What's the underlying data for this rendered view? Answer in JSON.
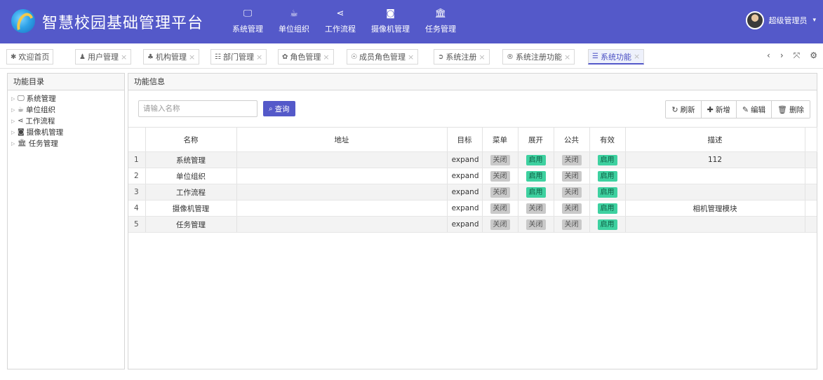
{
  "header": {
    "title": "智慧校园基础管理平台",
    "nav": [
      {
        "label": "系统管理",
        "icon": "monitor-icon",
        "glyph": "🖵"
      },
      {
        "label": "单位组织",
        "icon": "coffee-cup-icon",
        "glyph": "☕"
      },
      {
        "label": "工作流程",
        "icon": "share-icon",
        "glyph": "⋖"
      },
      {
        "label": "摄像机管理",
        "icon": "camera-icon",
        "glyph": "◙"
      },
      {
        "label": "任务管理",
        "icon": "bank-icon",
        "glyph": "🏛"
      }
    ],
    "user": {
      "name": "超级管理员",
      "caret": "▾"
    }
  },
  "tabs": [
    {
      "label": "欢迎首页",
      "glyph": "✱",
      "icon": "home-icon",
      "closable": false
    },
    {
      "label": "用户管理",
      "glyph": "♟",
      "icon": "user-icon",
      "closable": true
    },
    {
      "label": "机构管理",
      "glyph": "♣",
      "icon": "sitemap-icon",
      "closable": true
    },
    {
      "label": "部门管理",
      "glyph": "☷",
      "icon": "list-icon",
      "closable": true
    },
    {
      "label": "角色管理",
      "glyph": "✿",
      "icon": "paw-icon",
      "closable": true
    },
    {
      "label": "成员角色管理",
      "glyph": "☉",
      "icon": "reddit-icon",
      "closable": true
    },
    {
      "label": "系统注册",
      "glyph": "➲",
      "icon": "sign-in-icon",
      "closable": true
    },
    {
      "label": "系统注册功能",
      "glyph": "®",
      "icon": "registered-icon",
      "closable": true
    },
    {
      "label": "系统功能",
      "glyph": "☰",
      "icon": "bars-icon",
      "closable": true,
      "active": true
    }
  ],
  "tab_tools": {
    "prev": "‹",
    "next": "›",
    "fullscreen": "⤧",
    "settings": "⚙"
  },
  "left_panel": {
    "title": "功能目录",
    "tree": [
      {
        "label": "系统管理",
        "glyph": "🖵",
        "icon": "monitor-icon"
      },
      {
        "label": "单位组织",
        "glyph": "☕",
        "icon": "coffee-cup-icon"
      },
      {
        "label": "工作流程",
        "glyph": "⋖",
        "icon": "share-icon"
      },
      {
        "label": "摄像机管理",
        "glyph": "◙",
        "icon": "camera-icon"
      },
      {
        "label": "任务管理",
        "glyph": "🏛",
        "icon": "bank-icon"
      }
    ]
  },
  "right_panel": {
    "title": "功能信息",
    "search": {
      "placeholder": "请输入名称",
      "value": "",
      "button": "查询"
    },
    "toolbar": {
      "refresh": "刷新",
      "add": "新增",
      "edit": "编辑",
      "delete": "删除"
    },
    "columns": [
      "",
      "名称",
      "地址",
      "目标",
      "菜单",
      "展开",
      "公共",
      "有效",
      "描述"
    ],
    "rows": [
      {
        "n": "1",
        "name": "系统管理",
        "addr": "",
        "target": "expand",
        "menu": "关闭",
        "expand": "启用",
        "public": "关闭",
        "valid": "启用",
        "desc": "112"
      },
      {
        "n": "2",
        "name": "单位组织",
        "addr": "",
        "target": "expand",
        "menu": "关闭",
        "expand": "启用",
        "public": "关闭",
        "valid": "启用",
        "desc": ""
      },
      {
        "n": "3",
        "name": "工作流程",
        "addr": "",
        "target": "expand",
        "menu": "关闭",
        "expand": "启用",
        "public": "关闭",
        "valid": "启用",
        "desc": ""
      },
      {
        "n": "4",
        "name": "摄像机管理",
        "addr": "",
        "target": "expand",
        "menu": "关闭",
        "expand": "关闭",
        "public": "关闭",
        "valid": "启用",
        "desc": "相机管理模块"
      },
      {
        "n": "5",
        "name": "任务管理",
        "addr": "",
        "target": "expand",
        "menu": "关闭",
        "expand": "关闭",
        "public": "关闭",
        "valid": "启用",
        "desc": ""
      }
    ]
  },
  "colors": {
    "brand": "#5459c9",
    "on": "#3ed1a0",
    "off": "#c9c9c9"
  }
}
